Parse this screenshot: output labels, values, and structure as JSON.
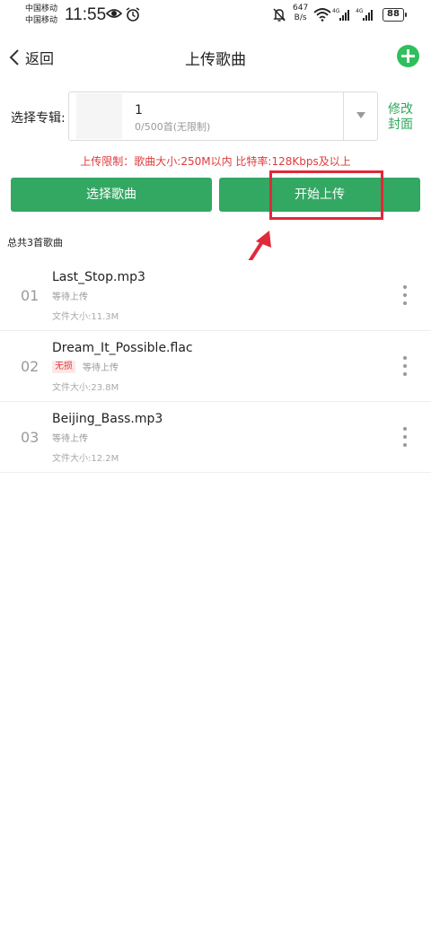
{
  "status_bar": {
    "carrier_1": "中国移动",
    "carrier_2": "中国移动",
    "time": "11:55",
    "speed_value": "647",
    "speed_unit": "B/s",
    "network_1": "4G",
    "network_2": "4G",
    "battery": "88",
    "icons": [
      "eye-icon",
      "alarm-icon",
      "mute-icon",
      "wifi-icon",
      "signal-icon",
      "battery-icon"
    ]
  },
  "nav": {
    "back_label": "返回",
    "title": "上传歌曲"
  },
  "album": {
    "label": "选择专辑:",
    "name": "1",
    "count": "0/500首(无限制)",
    "edit_cover": "修改封面"
  },
  "upload_limit": "上传限制：歌曲大小:250M以内 比特率:128Kbps及以上",
  "buttons": {
    "select_song": "选择歌曲",
    "start_upload": "开始上传"
  },
  "total_label": "总共3首歌曲",
  "songs": [
    {
      "num": "01",
      "name": "Last_Stop.mp3",
      "badge": "",
      "status": "等待上传",
      "size": "文件大小:11.3M"
    },
    {
      "num": "02",
      "name": "Dream_It_Possible.flac",
      "badge": "无损",
      "status": "等待上传",
      "size": "文件大小:23.8M"
    },
    {
      "num": "03",
      "name": "Beijing_Bass.mp3",
      "badge": "",
      "status": "等待上传",
      "size": "文件大小:12.2M"
    }
  ],
  "colors": {
    "accent": "#33a863",
    "highlight": "#e02a3a",
    "warning_text": "#e03a3a"
  }
}
